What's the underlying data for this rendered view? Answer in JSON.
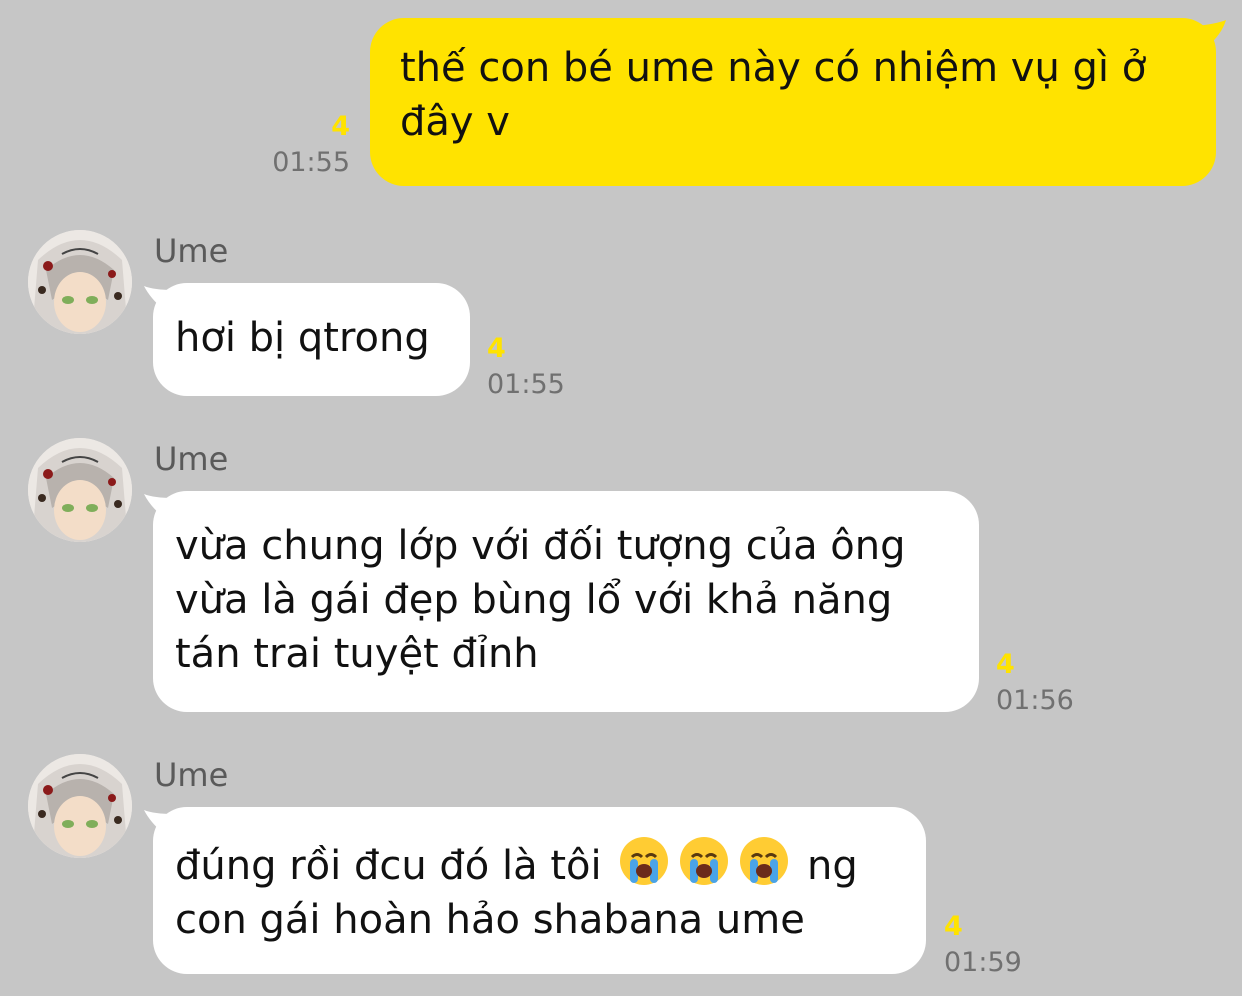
{
  "chat": {
    "messages": [
      {
        "direction": "out",
        "text": "thế con bé ume này có nhiệm vụ gì ở\nđây v",
        "unread": "4",
        "time": "01:55"
      },
      {
        "direction": "in",
        "sender": "Ume",
        "text": "hơi bị qtrong",
        "unread": "4",
        "time": "01:55"
      },
      {
        "direction": "in",
        "sender": "Ume",
        "text": "vừa chung lớp với đối tượng của ông\nvừa là gái đẹp bùng lổ với khả năng\ntán trai tuyệt đỉnh",
        "unread": "4",
        "time": "01:56"
      },
      {
        "direction": "in",
        "sender": "Ume",
        "text_before": "đúng rồi đcu đó là tôi",
        "emojis": [
          "loudly-crying-face",
          "loudly-crying-face",
          "loudly-crying-face"
        ],
        "text_after": "ng",
        "text_line2": "con gái hoàn hảo shabana ume",
        "unread": "4",
        "time": "01:59"
      }
    ]
  },
  "colors": {
    "background": "#c6c6c6",
    "outgoing_bubble": "#ffe300",
    "incoming_bubble": "#ffffff",
    "unread_count": "#ffe300",
    "timestamp": "#707070"
  }
}
